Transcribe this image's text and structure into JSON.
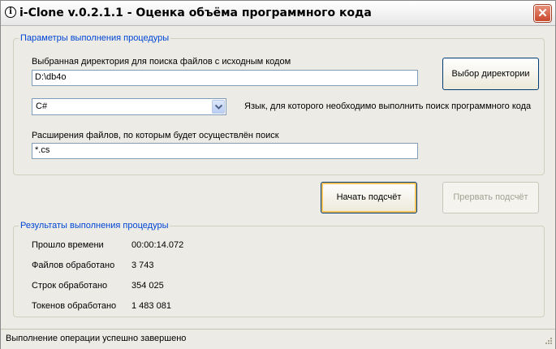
{
  "window": {
    "title": "i-Clone v.0.2.1.1 - Оценка объёма программного кода",
    "icon": "info-icon",
    "close_icon": "close-icon"
  },
  "params": {
    "legend": "Параметры выполнения процедуры",
    "dir_label": "Выбранная директория для поиска файлов с исходным кодом",
    "dir_value": "D:\\db4o",
    "choose_dir_button": "Выбор директории",
    "language_value": "C#",
    "language_label": "Язык, для которого необходимо выполнить поиск программного кода",
    "ext_label": "Расширения файлов, по которым будет осуществлён поиск",
    "ext_value": "*.cs"
  },
  "actions": {
    "start_button": "Начать подсчёт",
    "stop_button": "Прервать подсчёт"
  },
  "results": {
    "legend": "Результаты выполнения процедуры",
    "rows": [
      {
        "label": "Прошло времени",
        "value": "00:00:14.072"
      },
      {
        "label": "Файлов обработано",
        "value": "3 743"
      },
      {
        "label": "Строк обработано",
        "value": "354 025"
      },
      {
        "label": "Токенов обработано",
        "value": "1 483 081"
      }
    ]
  },
  "status": {
    "text": "Выполнение операции успешно завершено"
  },
  "colors": {
    "legend": "#0046d5",
    "close": "#c9472b"
  }
}
